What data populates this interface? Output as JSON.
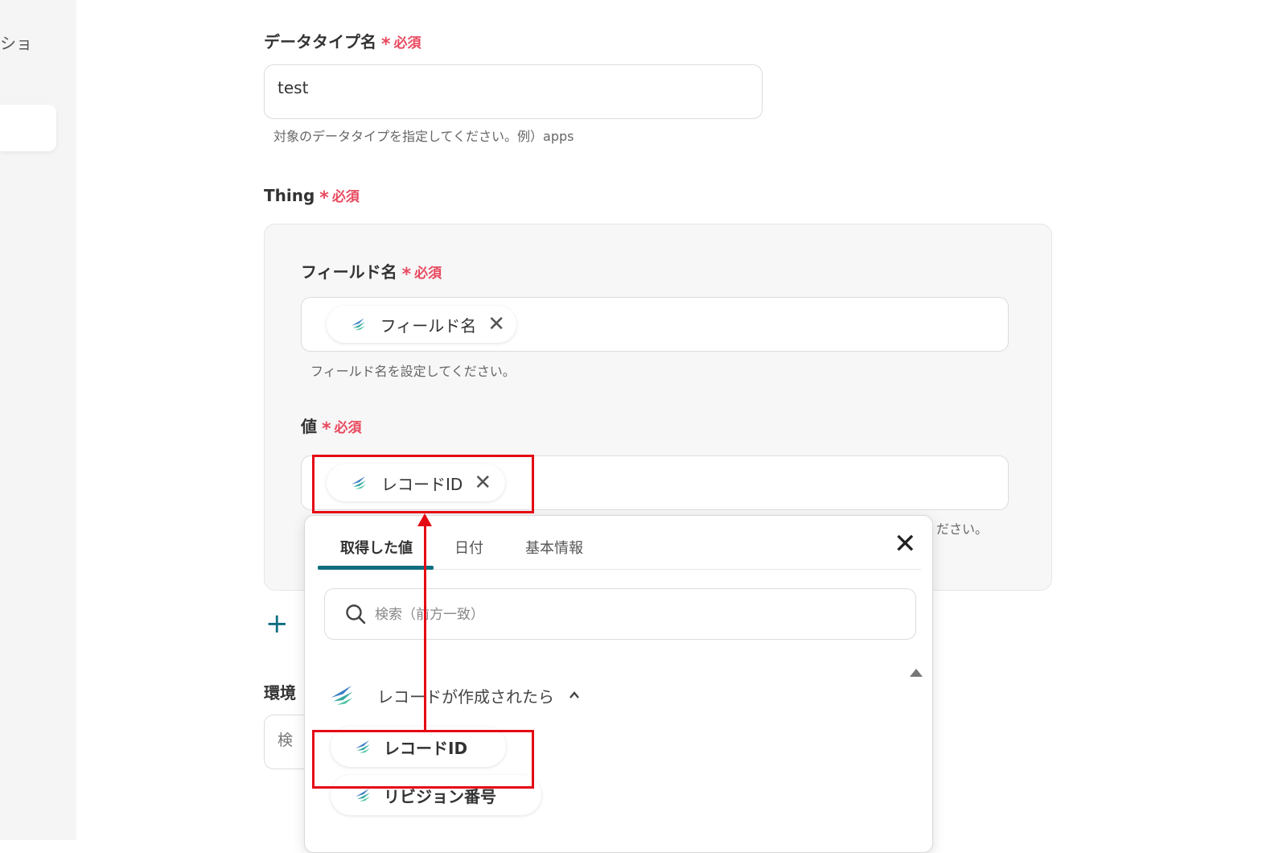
{
  "sidebar": {
    "partial_text": "ショ"
  },
  "datatype": {
    "label": "データタイプ名",
    "required": "必須",
    "star": "*",
    "value": "test",
    "hint": "対象のデータタイプを指定してください。例）apps"
  },
  "thing": {
    "label": "Thing",
    "required": "必須",
    "star": "*",
    "field_name": {
      "label": "フィールド名",
      "required": "必須",
      "star": "*",
      "chip": "フィールド名",
      "hint": "フィールド名を設定してください。"
    },
    "value": {
      "label": "値",
      "required": "必須",
      "star": "*",
      "chip": "レコードID",
      "hint_partial": "ください。"
    },
    "add_icon": "+"
  },
  "env": {
    "label_partial": "環境",
    "input_partial": "検"
  },
  "popup": {
    "tabs": [
      {
        "label": "取得した値",
        "active": true
      },
      {
        "label": "日付",
        "active": false
      },
      {
        "label": "基本情報",
        "active": false
      }
    ],
    "close_icon": "✕",
    "search_placeholder": "検索（前方一致）",
    "section_title": "レコードが作成されたら",
    "items": [
      "レコードID",
      "リビジョン番号"
    ]
  },
  "chip_close": "✕",
  "colors": {
    "accent": "#0e6e80",
    "required": "#e8495f",
    "highlight": "#e50914"
  },
  "icons": {
    "app": "app-logo-icon",
    "search": "search-icon",
    "close": "close-icon",
    "chevron": "chevron-up-icon"
  }
}
